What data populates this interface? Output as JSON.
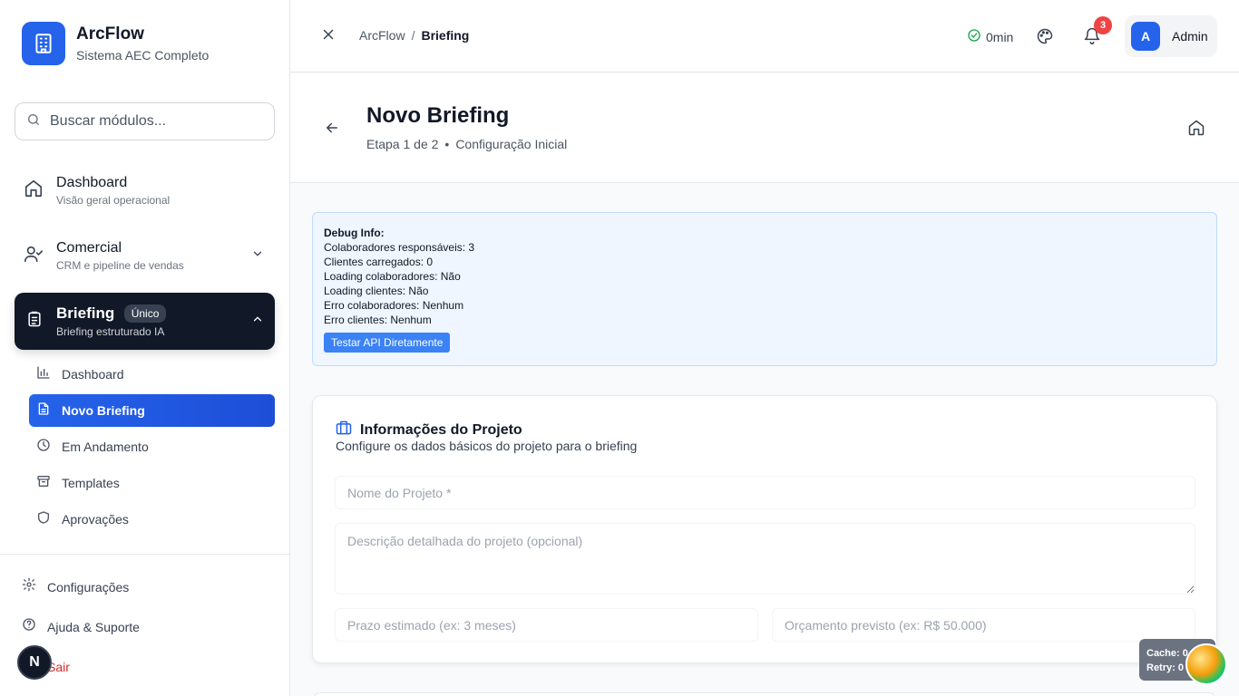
{
  "app": {
    "name": "ArcFlow",
    "subtitle": "Sistema AEC Completo"
  },
  "search": {
    "placeholder": "Buscar módulos..."
  },
  "nav": {
    "dashboard": {
      "label": "Dashboard",
      "sub": "Visão geral operacional"
    },
    "comercial": {
      "label": "Comercial",
      "sub": "CRM e pipeline de vendas"
    },
    "briefing": {
      "label": "Briefing",
      "badge": "Único",
      "sub": "Briefing estruturado IA"
    },
    "subitems": [
      {
        "label": "Dashboard",
        "icon": "bar-chart-icon"
      },
      {
        "label": "Novo Briefing",
        "icon": "file-text-icon",
        "active": true
      },
      {
        "label": "Em Andamento",
        "icon": "clock-icon"
      },
      {
        "label": "Templates",
        "icon": "archive-icon"
      },
      {
        "label": "Aprovações",
        "icon": "shield-icon"
      }
    ]
  },
  "footer": {
    "settings": "Configurações",
    "help": "Ajuda & Suporte",
    "logout": "Sair",
    "avatar_letter": "N"
  },
  "topbar": {
    "breadcrumb_root": "ArcFlow",
    "breadcrumb_sep": "/",
    "breadcrumb_current": "Briefing",
    "timer": "0min",
    "notifications": "3",
    "user_initial": "A",
    "user_name": "Admin"
  },
  "page": {
    "title": "Novo Briefing",
    "step": "Etapa 1 de 2",
    "step_dot": "•",
    "step_name": "Configuração Inicial"
  },
  "debug": {
    "title": "Debug Info:",
    "lines": [
      "Colaboradores responsáveis: 3",
      "Clientes carregados: 0",
      "Loading colaboradores: Não",
      "Loading clientes: Não",
      "Erro colaboradores: Nenhum",
      "Erro clientes: Nenhum"
    ],
    "button": "Testar API Diretamente"
  },
  "project_card": {
    "title": "Informações do Projeto",
    "subtitle": "Configure os dados básicos do projeto para o briefing",
    "name_placeholder": "Nome do Projeto *",
    "description_placeholder": "Descrição detalhada do projeto (opcional)",
    "deadline_placeholder": "Prazo estimado (ex: 3 meses)",
    "budget_placeholder": "Orçamento previsto (ex: R$ 50.000)"
  },
  "cache_widget": {
    "cache": "Cache: 0",
    "retry": "Retry: 0"
  },
  "colors": {
    "primary": "#2563eb",
    "dark": "#111827",
    "danger": "#ef4444",
    "success": "#16a34a"
  }
}
